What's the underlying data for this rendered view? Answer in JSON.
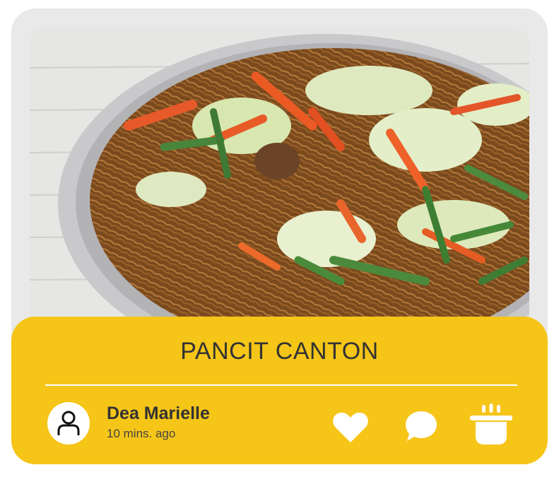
{
  "recipe": {
    "title": "PANCIT CANTON",
    "photo_alt": "Pancit canton noodles with carrots, cabbage and green beans"
  },
  "author": {
    "name": "Dea Marielle",
    "posted": "10 mins. ago"
  },
  "icons": {
    "avatar": "user-icon",
    "like": "heart-icon",
    "comment": "chat-bubble-icon",
    "cook": "cooking-pot-icon"
  },
  "colors": {
    "panel": "#f5c518",
    "card": "#e9e9e9",
    "text": "#333333",
    "icon": "#ffffff"
  }
}
